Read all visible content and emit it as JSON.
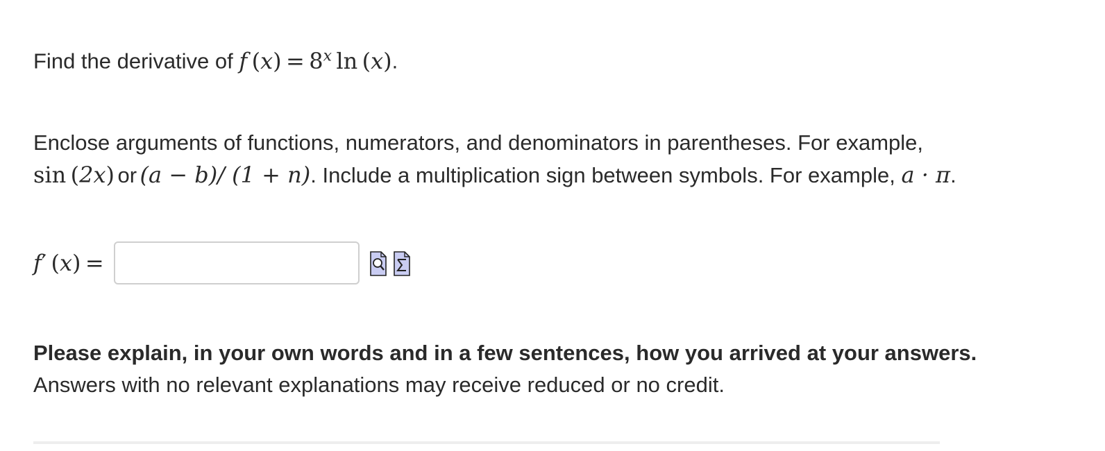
{
  "question": {
    "prefix": "Find the derivative of ",
    "function": "f",
    "var": "x",
    "equals": "=",
    "base": "8",
    "exponent": "x",
    "ln": "ln",
    "period": "."
  },
  "instructions": {
    "line1": "Enclose arguments of functions, numerators, and denominators in parentheses. For example,",
    "example1_fn": "sin",
    "example1_arg": "2x",
    "or_word": "or",
    "example2": "(a − b)/ (1 + n)",
    "text2": ". Include a multiplication sign between symbols. For example, ",
    "example3": "a · π",
    "period": "."
  },
  "answer": {
    "label_fn": "f",
    "label_prime": "′",
    "label_var": "x",
    "equals": "=",
    "input_value": "",
    "input_placeholder": "",
    "preview_icon": "preview-icon",
    "equation_editor_icon": "equation-editor-icon"
  },
  "explain": {
    "bold_text": "Please explain, in your own words and in a few sentences, how you arrived at your answers.",
    "note": "Answers with no relevant explanations may receive reduced or no credit."
  },
  "colors": {
    "text": "#2a2a2a",
    "input_border": "#cfcfcf",
    "icon_fill": "#c9ccf2",
    "icon_stroke": "#222222"
  }
}
